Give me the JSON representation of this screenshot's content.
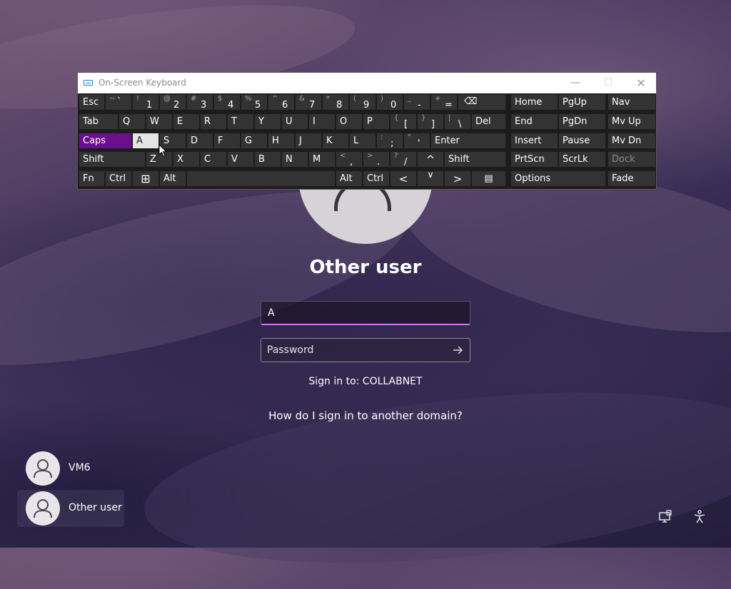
{
  "osk": {
    "title": "On-Screen Keyboard",
    "window_buttons": {
      "minimize": "—",
      "maximize": "☐",
      "close": "✕"
    },
    "row1": [
      {
        "label": "Esc"
      },
      {
        "shift": "~",
        "main": "`"
      },
      {
        "shift": "!",
        "main": "1"
      },
      {
        "shift": "@",
        "main": "2"
      },
      {
        "shift": "#",
        "main": "3"
      },
      {
        "shift": "$",
        "main": "4"
      },
      {
        "shift": "%",
        "main": "5"
      },
      {
        "shift": "^",
        "main": "6"
      },
      {
        "shift": "&",
        "main": "7"
      },
      {
        "shift": "*",
        "main": "8"
      },
      {
        "shift": "(",
        "main": "9"
      },
      {
        "shift": ")",
        "main": "0"
      },
      {
        "shift": "_",
        "main": "-"
      },
      {
        "shift": "+",
        "main": "="
      },
      {
        "label": "⌫"
      },
      {
        "label": "Home"
      },
      {
        "label": "PgUp"
      },
      {
        "label": "Nav"
      }
    ],
    "row2": [
      "Tab",
      "Q",
      "W",
      "E",
      "R",
      "T",
      "Y",
      "U",
      "I",
      "O",
      "P",
      {
        "shift": "{",
        "main": "["
      },
      {
        "shift": "}",
        "main": "]"
      },
      {
        "shift": "|",
        "main": "\\"
      },
      "Del",
      "End",
      "PgDn",
      "Mv Up"
    ],
    "row3": [
      "Caps",
      "A",
      "S",
      "D",
      "F",
      "G",
      "H",
      "J",
      "K",
      "L",
      {
        "shift": ":",
        "main": ";"
      },
      {
        "shift": "\"",
        "main": "'"
      },
      "Enter",
      "Insert",
      "Pause",
      "Mv Dn"
    ],
    "row4": [
      "Shift",
      "Z",
      "X",
      "C",
      "V",
      "B",
      "N",
      "M",
      {
        "shift": "<",
        "main": ","
      },
      {
        "shift": ">",
        "main": "."
      },
      {
        "shift": "?",
        "main": "/"
      },
      "^",
      "Shift",
      "PrtScn",
      "ScrLk",
      "Dock"
    ],
    "row5": [
      "Fn",
      "Ctrl",
      "⊞",
      "Alt",
      "",
      "Alt",
      "Ctrl",
      "<",
      "∨",
      ">",
      "▤",
      "Options",
      "Fade"
    ]
  },
  "login": {
    "user_title": "Other user",
    "username_value": "A",
    "password_placeholder": "Password",
    "sign_in_to": "Sign in to: COLLABNET",
    "other_domain_link": "How do I sign in to another domain?"
  },
  "users": [
    {
      "name": "VM6",
      "selected": false
    },
    {
      "name": "Other user",
      "selected": true
    }
  ],
  "colors": {
    "caps_active": "#6b0f8c",
    "input_focus": "#c879f0",
    "key_bg": "#333333"
  }
}
